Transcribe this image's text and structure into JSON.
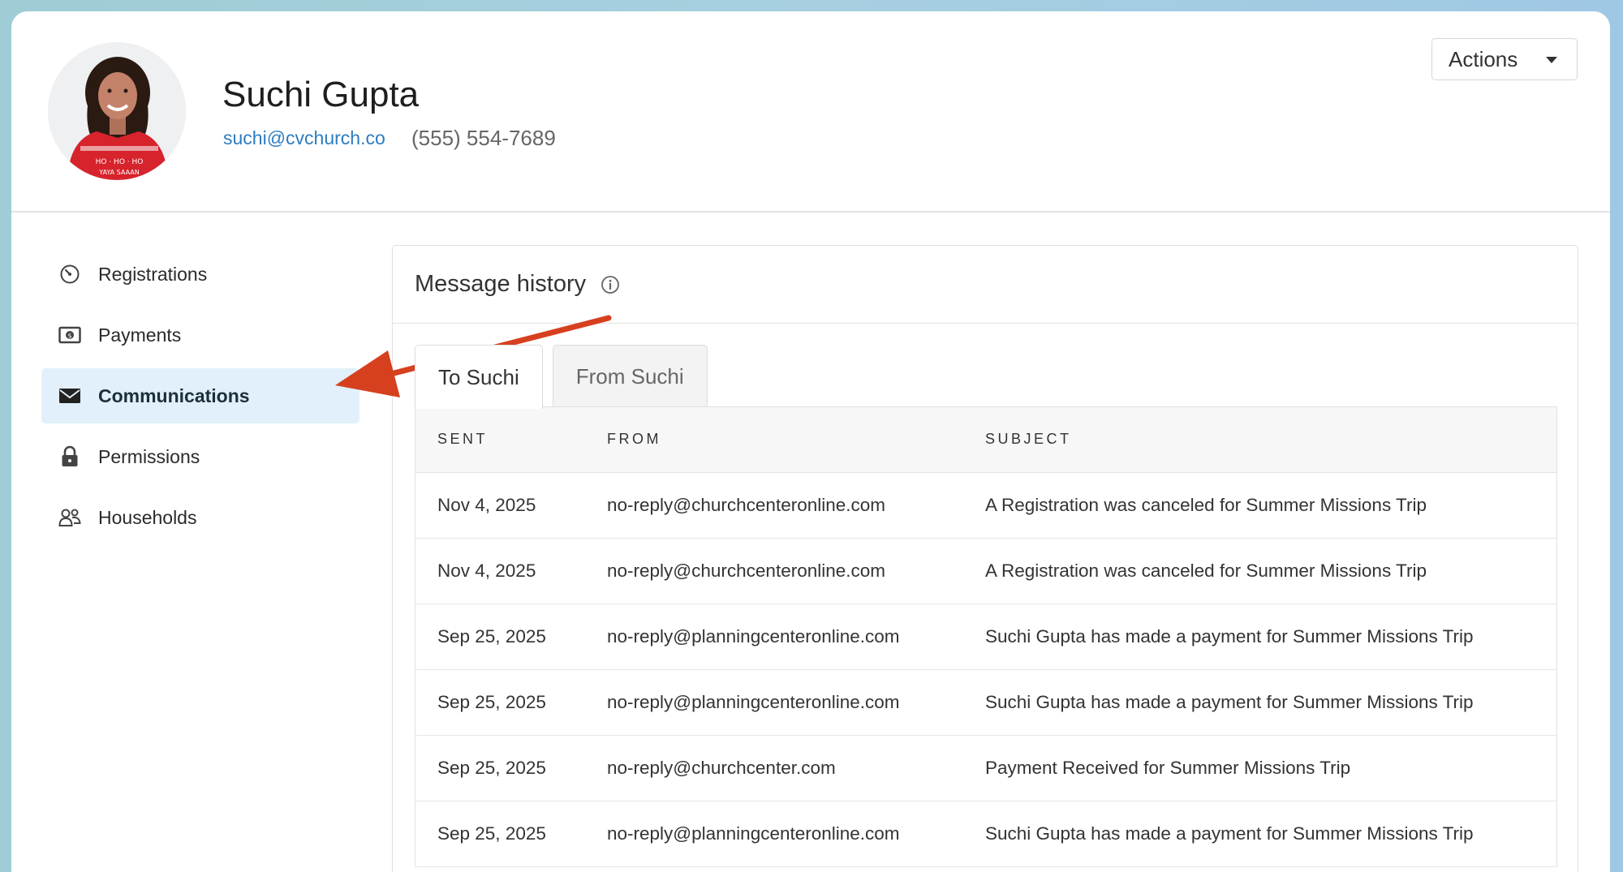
{
  "profile": {
    "name": "Suchi Gupta",
    "email": "suchi@cvchurch.co",
    "phone": "(555) 554-7689",
    "avatar_shirt_text_1": "HO · HO · HO",
    "avatar_shirt_text_2": "YAYA SAAAN"
  },
  "header": {
    "actions_label": "Actions"
  },
  "sidebar": {
    "items": [
      {
        "label": "Registrations",
        "icon": "gauge-icon",
        "active": false
      },
      {
        "label": "Payments",
        "icon": "money-icon",
        "active": false
      },
      {
        "label": "Communications",
        "icon": "envelope-icon",
        "active": true
      },
      {
        "label": "Permissions",
        "icon": "lock-icon",
        "active": false
      },
      {
        "label": "Households",
        "icon": "people-icon",
        "active": false
      }
    ]
  },
  "panel": {
    "title": "Message history",
    "tabs": [
      {
        "label": "To Suchi",
        "active": true
      },
      {
        "label": "From Suchi",
        "active": false
      }
    ],
    "columns": {
      "sent": "SENT",
      "from": "FROM",
      "subject": "SUBJECT"
    },
    "rows": [
      {
        "sent": "Nov 4, 2025",
        "from": "no-reply@churchcenteronline.com",
        "subject": "A Registration was canceled for Summer Missions Trip"
      },
      {
        "sent": "Nov 4, 2025",
        "from": "no-reply@churchcenteronline.com",
        "subject": "A Registration was canceled for Summer Missions Trip"
      },
      {
        "sent": "Sep 25, 2025",
        "from": "no-reply@planningcenteronline.com",
        "subject": "Suchi Gupta has made a payment for Summer Missions Trip"
      },
      {
        "sent": "Sep 25, 2025",
        "from": "no-reply@planningcenteronline.com",
        "subject": "Suchi Gupta has made a payment for Summer Missions Trip"
      },
      {
        "sent": "Sep 25, 2025",
        "from": "no-reply@churchcenter.com",
        "subject": "Payment Received for Summer Missions Trip"
      },
      {
        "sent": "Sep 25, 2025",
        "from": "no-reply@planningcenteronline.com",
        "subject": "Suchi Gupta has made a payment for Summer Missions Trip"
      }
    ]
  },
  "colors": {
    "accent_link": "#2d7dc0",
    "active_nav_bg": "#e1f0fb",
    "annotation_arrow": "#d6401f",
    "page_gradient": "#9ecdd6"
  }
}
